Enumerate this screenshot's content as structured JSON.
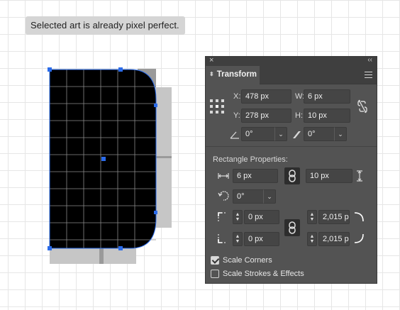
{
  "toast": {
    "message": "Selected art is already pixel perfect."
  },
  "panel": {
    "close_glyph": "×",
    "collapse_glyph": "‹‹",
    "tab_label": "Transform",
    "tab_icon": "⬍",
    "menu_icon": "hamburger-menu-icon",
    "x_label": "X:",
    "x_value": "478 px",
    "y_label": "Y:",
    "y_value": "278 px",
    "w_label": "W:",
    "w_value": "6 px",
    "h_label": "H:",
    "h_value": "10 px",
    "rotate_value": "0°",
    "shear_value": "0°",
    "section_title": "Rectangle Properties:",
    "rect_width": "6 px",
    "rect_height": "10 px",
    "rect_rotation": "0°",
    "corner_tl": "0 px",
    "corner_tr": "2,015 p",
    "corner_bl": "0 px",
    "corner_br": "2,015 p",
    "dropdown_glyph": "⌄",
    "scale_corners_label": "Scale Corners",
    "scale_corners_checked": true,
    "scale_strokes_label": "Scale Strokes & Effects",
    "scale_strokes_checked": false
  },
  "colors": {
    "panel_bg": "#535353",
    "field_bg": "#454545",
    "selection": "#2a6bea"
  }
}
